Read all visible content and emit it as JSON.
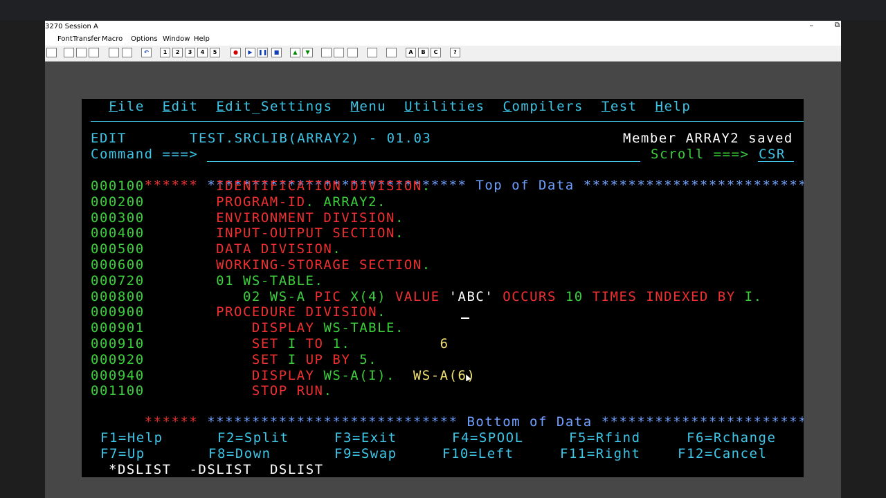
{
  "window": {
    "title": "3270 Session A",
    "minimize_glyph": "–",
    "restore_glyph": "⧉"
  },
  "menubar": [
    "Font",
    "Transfer",
    "Macro",
    "Options",
    "Window",
    "Help"
  ],
  "toolbar": {
    "icons": [
      "print-icon",
      "cut-icon",
      "copy-icon",
      "paste-icon",
      "send-icon",
      "receive-icon",
      "undo-icon",
      "macro-1-icon",
      "macro-2-icon",
      "macro-3-icon",
      "macro-4-icon",
      "macro-5-icon",
      "record-icon",
      "play-icon",
      "pause-icon",
      "stop-icon",
      "page-up-icon",
      "page-down-icon",
      "display-icon",
      "keypad-icon",
      "settings-icon",
      "transfer-icon",
      "session-icon",
      "abc-a-icon",
      "abc-b-icon",
      "abc-c-icon",
      "help-icon"
    ],
    "labels": [
      "",
      "",
      "",
      "",
      "",
      "",
      "↶",
      "1",
      "2",
      "3",
      "4",
      "5",
      "●",
      "▶",
      "❚❚",
      "■",
      "▲",
      "▼",
      "",
      "",
      "",
      "",
      "",
      "A",
      "B",
      "C",
      "?"
    ]
  },
  "ispf": {
    "menu": [
      "File",
      "Edit",
      "Edit_Settings",
      "Menu",
      "Utilities",
      "Compilers",
      "Test",
      "Help"
    ],
    "header": {
      "mode": "EDIT",
      "dataset": "TEST.SRCLIB(ARRAY2) - 01.03",
      "message": "Member ARRAY2 saved",
      "command_label": "Command ===>",
      "scroll_label": "Scroll ===>",
      "scroll_value": "CSR"
    },
    "top_marker": {
      "prefix": "******",
      "stars_left": "*****************************",
      "text": "Top of Data",
      "stars_right": "****************************************"
    },
    "bottom_marker": {
      "prefix": "******",
      "stars_left": "****************************",
      "text": "Bottom of Data",
      "stars_right": "**************************************"
    },
    "lines": [
      {
        "num": "000100",
        "pad": "        ",
        "segs": [
          {
            "t": "IDENTIFICATION DIVISION",
            "c": "red"
          },
          {
            "t": ".",
            "c": "green"
          }
        ]
      },
      {
        "num": "000200",
        "pad": "        ",
        "segs": [
          {
            "t": "PROGRAM-ID",
            "c": "red"
          },
          {
            "t": ". ARRAY2.",
            "c": "green"
          }
        ]
      },
      {
        "num": "000300",
        "pad": "        ",
        "segs": [
          {
            "t": "ENVIRONMENT DIVISION",
            "c": "red"
          },
          {
            "t": ".",
            "c": "green"
          }
        ]
      },
      {
        "num": "000400",
        "pad": "        ",
        "segs": [
          {
            "t": "INPUT-OUTPUT SECTION",
            "c": "red"
          },
          {
            "t": ".",
            "c": "green"
          }
        ]
      },
      {
        "num": "000500",
        "pad": "        ",
        "segs": [
          {
            "t": "DATA DIVISION",
            "c": "red"
          },
          {
            "t": ".",
            "c": "green"
          }
        ]
      },
      {
        "num": "000600",
        "pad": "        ",
        "segs": [
          {
            "t": "WORKING-STORAGE SECTION",
            "c": "red"
          },
          {
            "t": ".",
            "c": "green"
          }
        ]
      },
      {
        "num": "000720",
        "pad": "        ",
        "segs": [
          {
            "t": "01 WS-TABLE.",
            "c": "green"
          }
        ]
      },
      {
        "num": "000800",
        "pad": "           ",
        "segs": [
          {
            "t": "02 WS-A ",
            "c": "green"
          },
          {
            "t": "PIC ",
            "c": "red"
          },
          {
            "t": "X(4) ",
            "c": "green"
          },
          {
            "t": "VALUE ",
            "c": "red"
          },
          {
            "t": "'ABC' ",
            "c": "white"
          },
          {
            "t": "OCCURS ",
            "c": "red"
          },
          {
            "t": "10 ",
            "c": "green"
          },
          {
            "t": "TIMES INDEXED BY ",
            "c": "red"
          },
          {
            "t": "I.",
            "c": "green"
          }
        ]
      },
      {
        "num": "000900",
        "pad": "        ",
        "segs": [
          {
            "t": "PROCEDURE DIVISION",
            "c": "red"
          },
          {
            "t": ".",
            "c": "green"
          }
        ]
      },
      {
        "num": "000901",
        "pad": "            ",
        "segs": [
          {
            "t": "DISPLAY ",
            "c": "red"
          },
          {
            "t": "WS-TABLE.",
            "c": "green"
          }
        ]
      },
      {
        "num": "000910",
        "pad": "            ",
        "segs": [
          {
            "t": "SET ",
            "c": "red"
          },
          {
            "t": "I ",
            "c": "green"
          },
          {
            "t": "TO ",
            "c": "red"
          },
          {
            "t": "1.",
            "c": "green"
          },
          {
            "t": "          6",
            "c": "yellow"
          }
        ]
      },
      {
        "num": "000920",
        "pad": "            ",
        "segs": [
          {
            "t": "SET ",
            "c": "red"
          },
          {
            "t": "I ",
            "c": "green"
          },
          {
            "t": "UP BY ",
            "c": "red"
          },
          {
            "t": "5.",
            "c": "green"
          }
        ]
      },
      {
        "num": "000940",
        "pad": "            ",
        "segs": [
          {
            "t": "DISPLAY ",
            "c": "red"
          },
          {
            "t": "WS-A(I).",
            "c": "green"
          },
          {
            "t": "  WS-A(6)",
            "c": "yellow"
          }
        ]
      },
      {
        "num": "001100",
        "pad": "            ",
        "segs": [
          {
            "t": "STOP RUN",
            "c": "red"
          },
          {
            "t": ".",
            "c": "green"
          }
        ]
      }
    ],
    "fkeys_row1": [
      "F1=Help",
      "F2=Split",
      "F3=Exit",
      "F4=SPOOL",
      "F5=Rfind",
      "F6=Rchange"
    ],
    "fkeys_row2": [
      "F7=Up",
      "F8=Down",
      "F9=Swap",
      "F10=Left",
      "F11=Right",
      "F12=Cancel"
    ],
    "session_tabs": [
      "*DSLIST",
      "-DSLIST",
      "DSLIST"
    ]
  }
}
